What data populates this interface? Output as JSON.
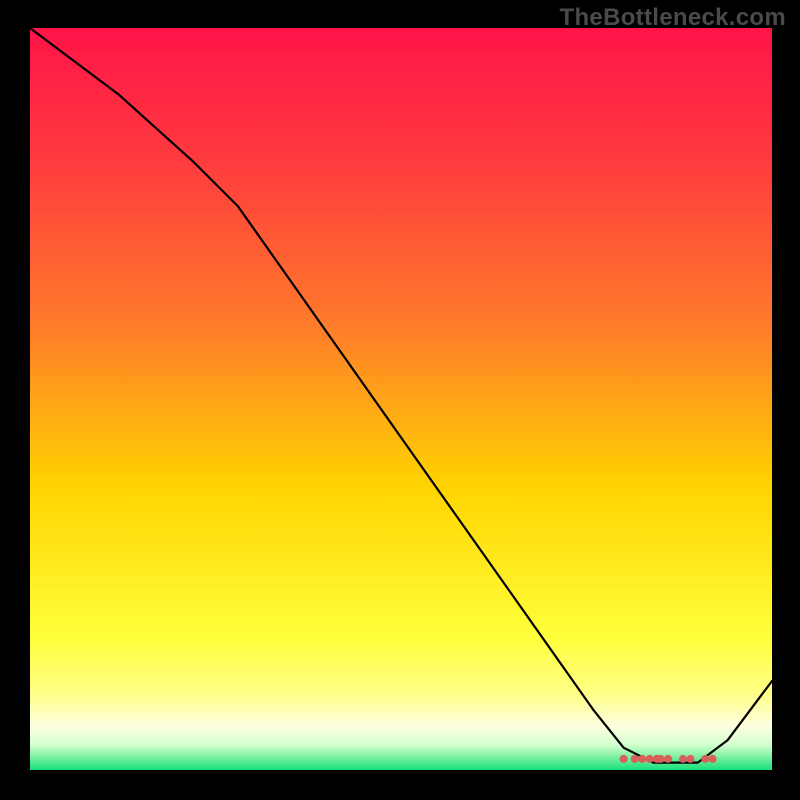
{
  "watermark": "TheBottleneck.com",
  "chart_data": {
    "type": "line",
    "title": "",
    "xlabel": "",
    "ylabel": "",
    "xlim": [
      0,
      100
    ],
    "ylim": [
      0,
      100
    ],
    "background_gradient": {
      "top": "#ff1448",
      "mid1": "#ff7b2a",
      "mid2": "#ffd400",
      "low": "#ffff8a",
      "band": "#fdffe0",
      "bottom": "#18e07a"
    },
    "series": [
      {
        "name": "bottleneck-curve",
        "x": [
          0,
          12,
          22,
          28,
          40,
          52,
          64,
          76,
          80,
          84,
          88,
          90,
          94,
          100
        ],
        "y": [
          100,
          91,
          82,
          76,
          59,
          42,
          25,
          8,
          3,
          1,
          1,
          1,
          4,
          12
        ]
      }
    ],
    "markers": {
      "name": "highlight-dots",
      "color": "#d9605a",
      "points": [
        {
          "x": 80,
          "y": 1.5
        },
        {
          "x": 81.5,
          "y": 1.5
        },
        {
          "x": 82.5,
          "y": 1.5
        },
        {
          "x": 83.5,
          "y": 1.5
        },
        {
          "x": 84.5,
          "y": 1.5
        },
        {
          "x": 85,
          "y": 1.5
        },
        {
          "x": 86,
          "y": 1.5
        },
        {
          "x": 88,
          "y": 1.5
        },
        {
          "x": 89,
          "y": 1.5
        },
        {
          "x": 91,
          "y": 1.5
        },
        {
          "x": 92,
          "y": 1.5
        }
      ]
    }
  }
}
